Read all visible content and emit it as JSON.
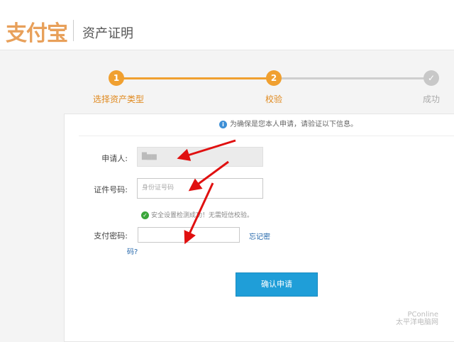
{
  "header": {
    "logo_text": "支付宝",
    "title": "资产证明"
  },
  "steps": [
    {
      "number": "1",
      "label": "选择资产类型",
      "state": "done"
    },
    {
      "number": "2",
      "label": "校验",
      "state": "active"
    },
    {
      "number": "✓",
      "label": "成功",
      "state": "pending"
    }
  ],
  "notice": {
    "text": "为确保是您本人申请，请验证以下信息。"
  },
  "form": {
    "applicant_label": "申请人:",
    "applicant_value": "█▆▆",
    "id_label": "证件号码:",
    "id_placeholder": "身份证号码",
    "security_ok": "安全设置检测成功！无需短信校验。",
    "password_label": "支付密码:",
    "forgot_part1": "忘记密",
    "forgot_part2": "码?",
    "submit": "确认申请"
  },
  "watermark": {
    "line1": "PConline",
    "line2": "太平洋电脑网"
  },
  "colors": {
    "accent": "#f0a030",
    "button": "#1f9ed8",
    "arrow": "#e01010"
  }
}
